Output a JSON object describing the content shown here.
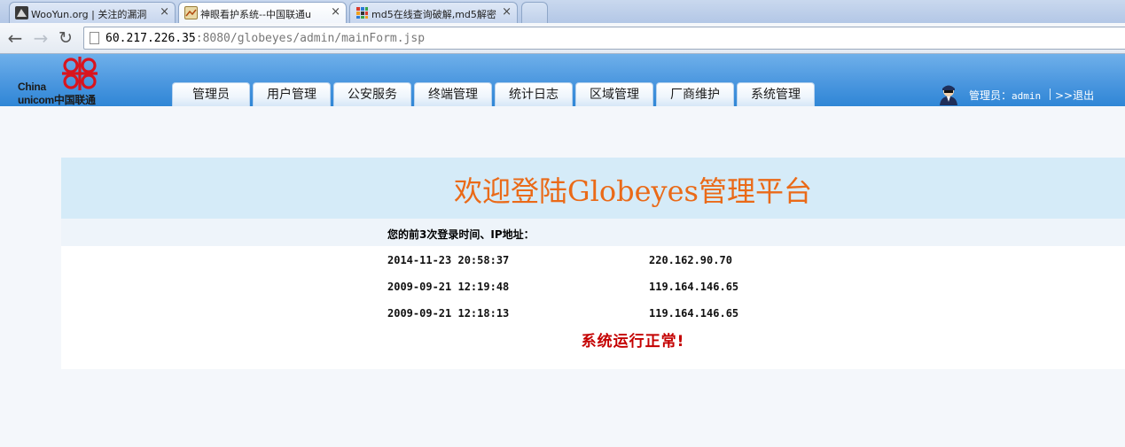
{
  "browser": {
    "tabs": [
      {
        "title": "WooYun.org | 关注的漏洞",
        "active": false,
        "favicon": "wooyun-icon"
      },
      {
        "title": "神眼看护系统--中国联通u",
        "active": true,
        "favicon": "page-thumbnail-icon"
      },
      {
        "title": "md5在线查询破解,md5解密",
        "active": false,
        "favicon": "grid-icon"
      }
    ],
    "close_glyph": "×",
    "back_glyph": "←",
    "forward_glyph": "→",
    "reload_glyph": "↻",
    "url_host": "60.217.226.35",
    "url_rest": ":8080/globeyes/admin/mainForm.jsp"
  },
  "header": {
    "logo_line1": "China",
    "logo_line2": "unicom中国联通",
    "menu": [
      "管理员",
      "用户管理",
      "公安服务",
      "终端管理",
      "统计日志",
      "区域管理",
      "厂商维护",
      "系统管理"
    ],
    "user_label": "管理员：",
    "user_name": "admin",
    "logout": ">>退出"
  },
  "main": {
    "welcome_title": "欢迎登陆Globeyes管理平台",
    "login_caption": "您的前3次登录时间、IP地址：",
    "logins": [
      {
        "time": "2014-11-23 20:58:37",
        "ip": "220.162.90.70"
      },
      {
        "time": "2009-09-21 12:19:48",
        "ip": "119.164.146.65"
      },
      {
        "time": "2009-09-21 12:18:13",
        "ip": "119.164.146.65"
      }
    ],
    "status": "系统运行正常!"
  },
  "colors": {
    "header_blue": "#4b97df",
    "title_orange": "#ea6a18",
    "status_red": "#c40000",
    "logo_red": "#d9141e"
  }
}
